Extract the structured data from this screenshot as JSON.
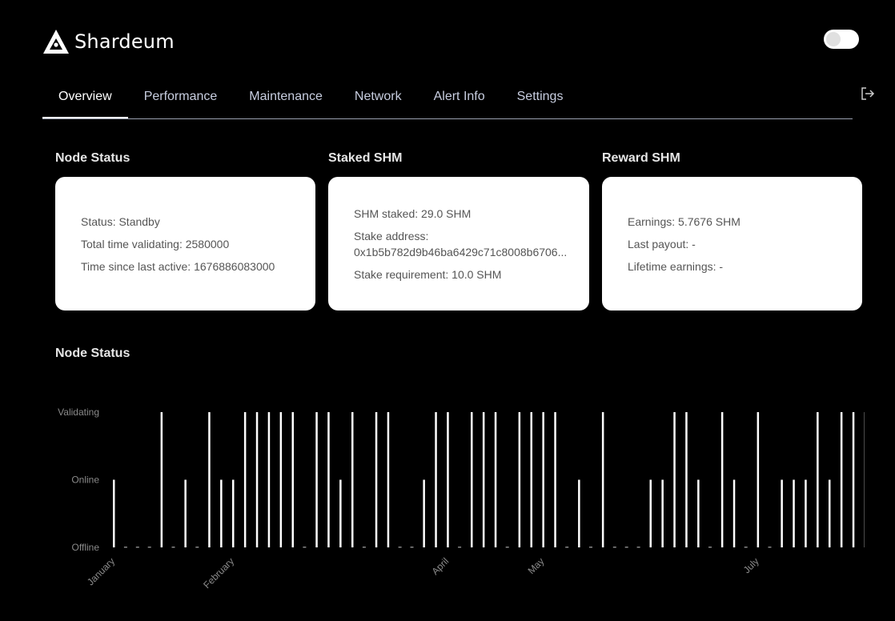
{
  "app": {
    "name": "Shardeum"
  },
  "tabs": [
    "Overview",
    "Performance",
    "Maintenance",
    "Network",
    "Alert Info",
    "Settings"
  ],
  "active_tab": "Overview",
  "theme_toggle": {
    "state": "off"
  },
  "icons": {
    "logo": "shardeum-logo-icon",
    "logout": "logout-icon"
  },
  "sections": {
    "node_status": "Node Status",
    "staked": "Staked SHM",
    "reward": "Reward SHM",
    "chart": "Node Status"
  },
  "node_status_card": {
    "status": "Status: Standby",
    "total_time": "Total time validating: 2580000",
    "time_since": "Time since last active: 1676886083000"
  },
  "staked_card": {
    "staked": "SHM staked: 29.0 SHM",
    "address_label": "Stake address:",
    "address": "0x1b5b782d9b46ba6429c71c8008b6706...",
    "requirement": "Stake requirement: 10.0 SHM"
  },
  "reward_card": {
    "earnings": "Earnings: 5.7676 SHM",
    "last_payout": "Last payout: -",
    "lifetime": "Lifetime earnings: -"
  },
  "colors": {
    "background": "#000000",
    "card": "#ffffff",
    "bar": "#ffffff",
    "axis_label": "#8a8a8a",
    "tab_text": "#c8cee0"
  },
  "chart_data": {
    "type": "bar",
    "title": "Node Status",
    "y_categories": [
      "Offline",
      "Online",
      "Validating"
    ],
    "x_tick_labels": [
      {
        "label": "January",
        "index": 0
      },
      {
        "label": "February",
        "index": 10
      },
      {
        "label": "April",
        "index": 28
      },
      {
        "label": "May",
        "index": 36
      },
      {
        "label": "July",
        "index": 54
      }
    ],
    "values": [
      1,
      0,
      0,
      0,
      2,
      0,
      1,
      0,
      2,
      1,
      1,
      2,
      2,
      2,
      2,
      2,
      0,
      2,
      2,
      1,
      2,
      0,
      2,
      2,
      0,
      0,
      1,
      2,
      2,
      0,
      2,
      2,
      2,
      0,
      2,
      2,
      2,
      2,
      0,
      1,
      0,
      2,
      0,
      0,
      0,
      1,
      1,
      2,
      2,
      1,
      0,
      2,
      1,
      0,
      2,
      0,
      1,
      1,
      1,
      2,
      1,
      2,
      2,
      2,
      1,
      0
    ],
    "grid": false,
    "legend": "none"
  }
}
